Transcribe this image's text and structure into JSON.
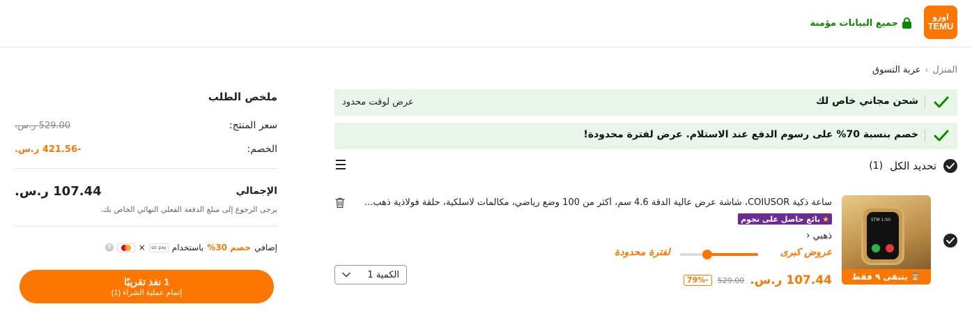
{
  "header": {
    "logo_glyphs": "اوزو",
    "logo_text": "TEMU",
    "secure_text": "جميع البيانات مؤمنة",
    "colors": {
      "brand": "#fb7701",
      "secure": "#0a8800"
    }
  },
  "breadcrumb": {
    "home": "المنزل",
    "separator": "›",
    "current": "عربة التسوق"
  },
  "banners": [
    {
      "title": "شحن مجاني خاص لك",
      "note": "عرض لوقت محدود"
    },
    {
      "title": "خصم بنسبة 70% على رسوم الدفع عند الاستلام. عرض لفترة محدودة!",
      "note": ""
    }
  ],
  "cart": {
    "select_all_label": "تحديد الكل",
    "select_all_count": "(1)",
    "items": [
      {
        "title": "ساعة ذكية COIUSOR، شاشة عرض عالية الدقة 4.6 سم، أكثر من 100 وضع رياضي، مكالمات لاسلكية، حلقة فولاذية ذهب...",
        "seller_badge": "بائع حاصل على نجوم",
        "variant": "ذهبي",
        "deal_label": "عروض كبرى",
        "limited_label": "لفترة محدودة",
        "deal_progress": 0.65,
        "stock_badge": "يتبقى ٩ فقط",
        "watch_time": "1:50 STM",
        "price": "107.44 ر.س.",
        "old_price": "529.00",
        "discount": "-79%",
        "quantity_label": "الكمية 1"
      }
    ]
  },
  "summary": {
    "title": "ملخص الطلب",
    "product_price_label": "سعر المنتج:",
    "product_price_value": "529.00 ر.س.",
    "discount_label": "الخصم:",
    "discount_value": "-421.56 ر.س.",
    "total_label": "الإجمالي",
    "total_value": "107.44 ر.س.",
    "total_note": "يرجى الرجوع إلى مبلغ الدفعة الفعلي النهائي الخاص بك.",
    "extra_prefix": "إضافي",
    "extra_pct": "خصم 30%",
    "extra_suffix": "باستخدام",
    "times": "×",
    "info": "?",
    "stc_label": "stc pay",
    "checkout_line1": "1 نفذ تقريبًا",
    "checkout_line2": "إتمام عملية الشراء (1)"
  }
}
